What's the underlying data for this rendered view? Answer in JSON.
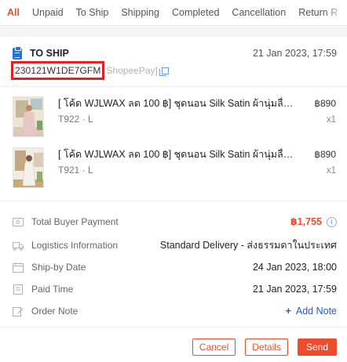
{
  "tabs": [
    "All",
    "Unpaid",
    "To Ship",
    "Shipping",
    "Completed",
    "Cancellation",
    "Return R"
  ],
  "active_tab": "All",
  "order": {
    "status": "TO SHIP",
    "date": "21 Jan 2023, 17:59",
    "order_id": "230121W1DE7GFM",
    "payment_method": "ShopeePay]"
  },
  "products": [
    {
      "name": "[ โค้ด WJLWAX ลด 100 ฿] ชุดนอน Silk Satin ผ้านุ่มลื่น…",
      "variant": "T922 · L",
      "price": "฿890",
      "qty": "x1"
    },
    {
      "name": "[ โค้ด WJLWAX ลด 100 ฿] ชุดนอน Silk Satin ผ้านุ่มลื่น…",
      "variant": "T921 · L",
      "price": "฿890",
      "qty": "x1"
    }
  ],
  "info": {
    "total_label": "Total Buyer Payment",
    "total_value": "฿1,755",
    "logistics_label": "Logistics Information",
    "logistics_value": "Standard Delivery - ส่งธรรมดาในประเทศ",
    "shipby_label": "Ship-by Date",
    "shipby_value": "24 Jan 2023, 18:00",
    "paid_label": "Paid Time",
    "paid_value": "21 Jan 2023, 17:59",
    "note_label": "Order Note",
    "note_action": "Add Note",
    "info_glyph": "i"
  },
  "actions": {
    "cancel": "Cancel",
    "details": "Details",
    "send": "Send"
  },
  "colors": {
    "accent": "#ee4d2d",
    "link": "#2a5bb8",
    "highlight_box": "#e32027"
  }
}
